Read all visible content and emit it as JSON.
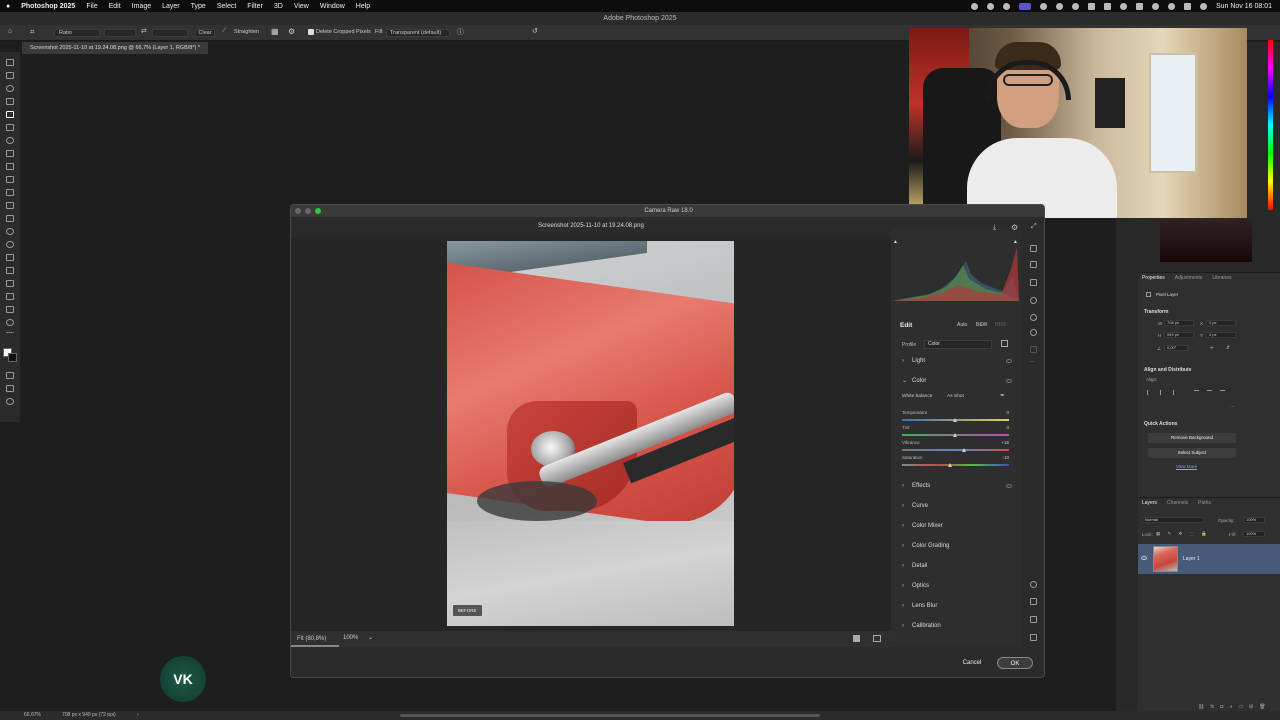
{
  "menubar": {
    "app": "Photoshop 2025",
    "items": [
      "File",
      "Edit",
      "Image",
      "Layer",
      "Type",
      "Select",
      "Filter",
      "3D",
      "View",
      "Window",
      "Help"
    ],
    "clock": "Sun Nov 16  08:01"
  },
  "window": {
    "title": "Adobe Photoshop 2025"
  },
  "options": {
    "ratio": "Ratio",
    "clear": "Clear",
    "straighten": "Straighten",
    "delete_cropped": "Delete Cropped Pixels",
    "fill_label": "Fill:",
    "fill_value": "Transparent (default)"
  },
  "document": {
    "tab": "Screenshot 2025-11-10 at 19.24.08.png @ 66,7% (Layer 1, RGB/8*) *"
  },
  "camera_raw": {
    "title": "Camera Raw 18.0",
    "file": "Screenshot 2025-11-10 at 19.24.08.png",
    "before_label": "BEFORE",
    "zoom_fit": "Fit (80,8%)",
    "zoom_100": "100%",
    "edit": {
      "heading": "Edit",
      "auto": "Auto",
      "bw": "B&W",
      "hdr": "HDR",
      "profile_label": "Profile",
      "profile_value": "Color"
    },
    "sections": [
      "Light",
      "Color",
      "Effects",
      "Curve",
      "Color Mixer",
      "Color Grading",
      "Detail",
      "Optics",
      "Lens Blur",
      "Calibration"
    ],
    "white_balance_label": "White balance",
    "white_balance_value": "As Shot",
    "sliders": [
      {
        "label": "Temperature",
        "value": "0",
        "pos": 0.5
      },
      {
        "label": "Tint",
        "value": "0",
        "pos": 0.5
      },
      {
        "label": "Vibrance",
        "value": "+16",
        "pos": 0.58
      },
      {
        "label": "Saturation",
        "value": "-10",
        "pos": 0.45
      }
    ],
    "cancel": "Cancel",
    "ok": "OK"
  },
  "properties": {
    "tabs": [
      "Properties",
      "Adjustments",
      "Libraries"
    ],
    "pixel_layer": "Pixel Layer",
    "transform": "Transform",
    "w": "708 px",
    "x": "0 px",
    "h": "949 px",
    "y": "0 px",
    "angle": "0,00°",
    "align": "Align and Distribute",
    "align_sub": "Align:",
    "quick_actions": "Quick Actions",
    "remove_bg": "Remove Background",
    "select_subject": "Select Subject",
    "view_more": "View More"
  },
  "layers": {
    "tabs": [
      "Layers",
      "Channels",
      "Paths"
    ],
    "blend": "Normal",
    "opacity_label": "Opacity:",
    "opacity": "100%",
    "lock": "Lock:",
    "fill_label": "Fill:",
    "fill": "100%",
    "layer_name": "Layer 1"
  },
  "status": {
    "zoom": "66,67%",
    "info": "708 px x 949 px (72 ppi)"
  },
  "watermark": "VK"
}
